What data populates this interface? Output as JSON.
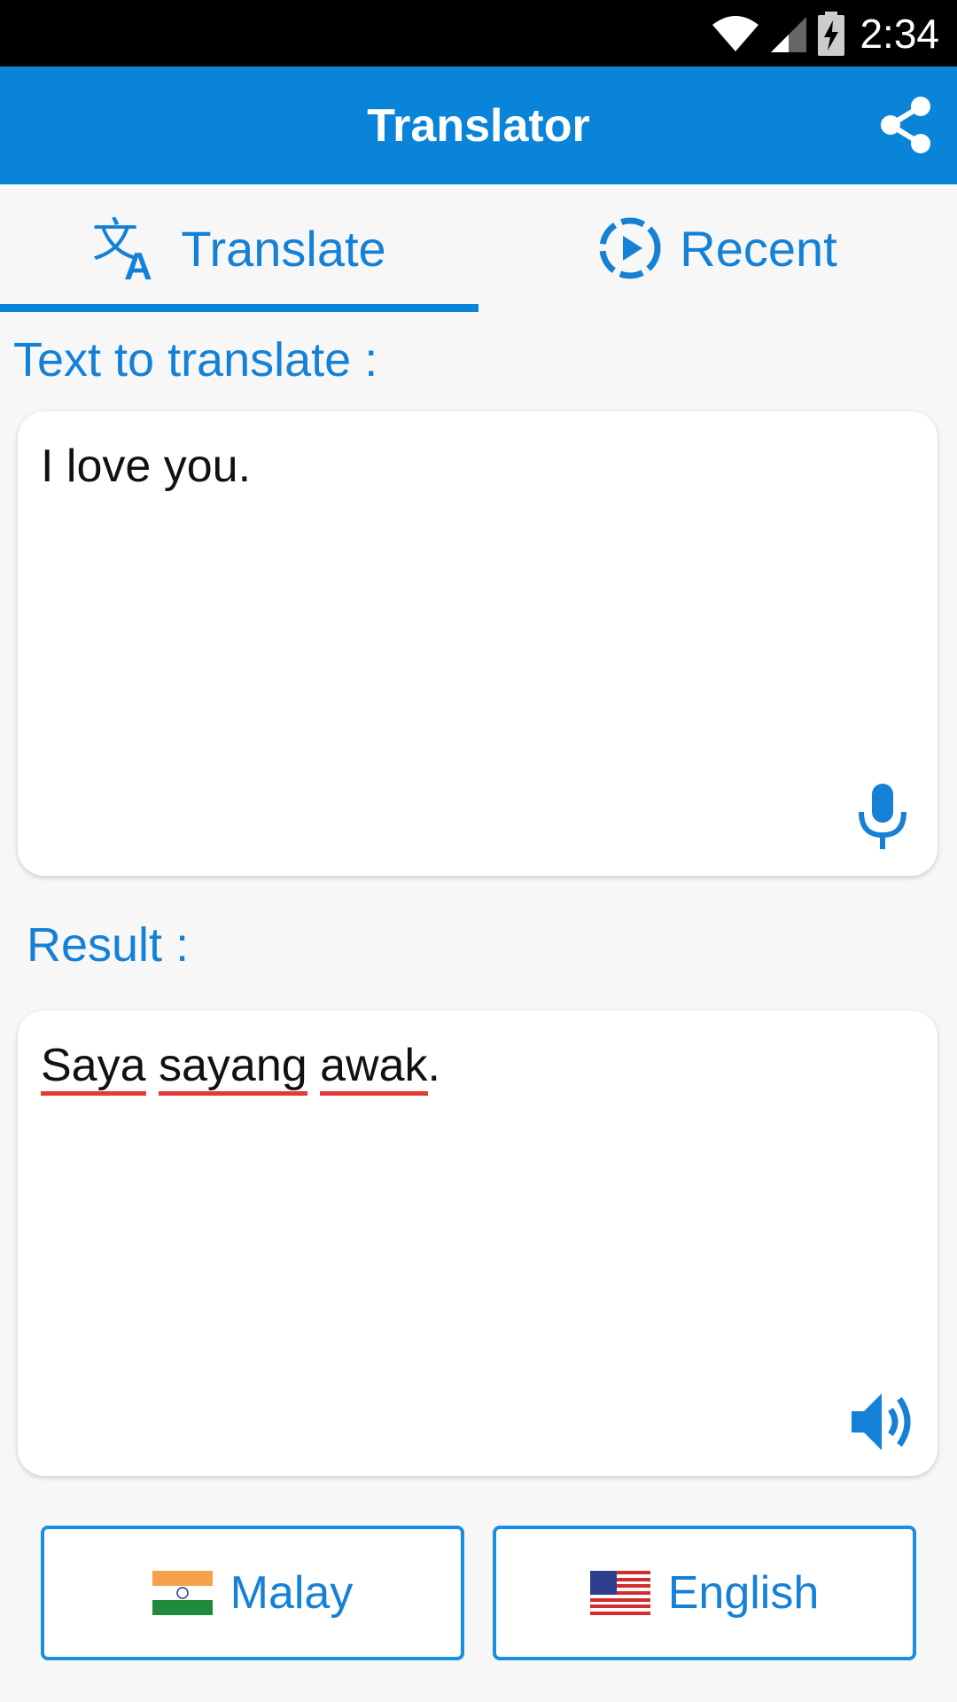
{
  "status_bar": {
    "time": "2:34"
  },
  "app_bar": {
    "title": "Translator",
    "share_icon": "share-icon"
  },
  "tabs": [
    {
      "label": "Translate",
      "icon": "translate-icon",
      "selected": true
    },
    {
      "label": "Recent",
      "icon": "recent-play-icon",
      "selected": false
    }
  ],
  "input_section": {
    "label": "Text to translate :",
    "text": "I love you.",
    "mic_icon": "microphone-icon"
  },
  "result_section": {
    "label": "Result :",
    "words": [
      "Saya",
      "sayang",
      "awak"
    ],
    "punctuation": ".",
    "speaker_icon": "speaker-icon"
  },
  "language_buttons": {
    "source": {
      "label": "Malay",
      "flag": "india-flag-icon"
    },
    "target": {
      "label": "English",
      "flag": "us-flag-icon"
    }
  },
  "colors": {
    "primary": "#0a84d8",
    "accent_text": "#1581d6",
    "spell_underline": "#e53935",
    "background": "#f7f7f7"
  }
}
